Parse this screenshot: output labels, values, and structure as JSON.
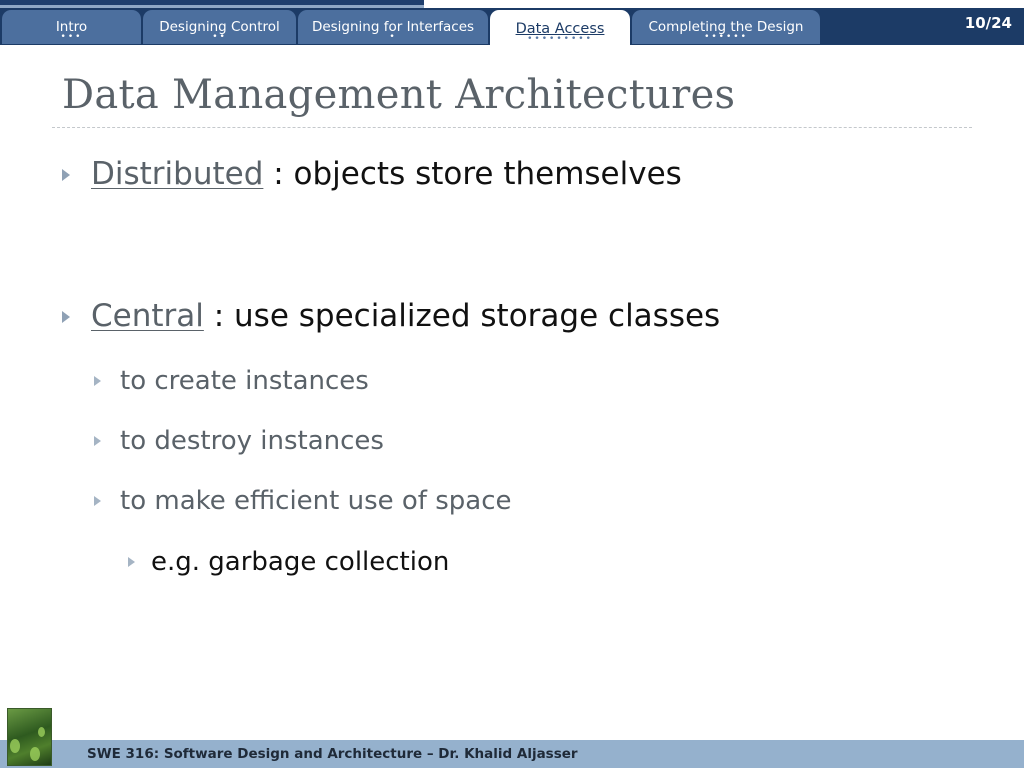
{
  "nav": {
    "tabs": [
      {
        "label": "Intro",
        "dots": "•••",
        "active": false
      },
      {
        "label": "Designing Control",
        "dots": "••",
        "active": false
      },
      {
        "label": "Designing for Interfaces",
        "dots": "•",
        "active": false
      },
      {
        "label": "Data Access",
        "dots": "•••••••••",
        "active": true
      },
      {
        "label": "Completing the Design",
        "dots": "••••••",
        "active": false
      }
    ],
    "page_counter": "10/24"
  },
  "slide": {
    "title": "Data Management Architectures",
    "bullets": [
      {
        "term": "Distributed",
        "text": " : objects store themselves"
      },
      {
        "term": "Central",
        "text": " : use specialized storage classes"
      }
    ],
    "sub_bullets": [
      "to create instances",
      "to destroy instances",
      "to make efficient use of space"
    ],
    "sub_sub_bullet": "e.g.  garbage collection"
  },
  "footer": {
    "text": "SWE 316: Software Design and Architecture – Dr. Khalid Aljasser"
  },
  "colors": {
    "nav_bar": "#1c3b66",
    "tab_inactive": "#4c6f9e",
    "footer_bar": "#95b1cd",
    "title_text": "#5a6269",
    "bullet_arrow": "#8fa1b5"
  },
  "icons": {
    "bullet": "triangle-right-icon",
    "book": "book-cover-thumbnail"
  }
}
